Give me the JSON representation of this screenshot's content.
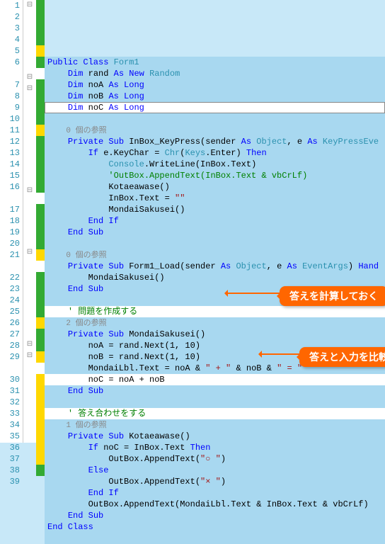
{
  "callouts": {
    "c1": "答えを計算しておく",
    "c2": "答えと入力を比較"
  },
  "refs": {
    "r0": "0 個の参照",
    "r1": "1 個の参照",
    "r2": "2 個の参照"
  },
  "lines": [
    {
      "n": "1",
      "mk": "⊟",
      "mg": "g",
      "cls": "hl",
      "tokens": [
        [
          "kw",
          "Public Class "
        ],
        [
          "tp",
          "Form1"
        ]
      ]
    },
    {
      "n": "2",
      "mg": "g",
      "cls": "hl",
      "tokens": [
        [
          "mt",
          "    "
        ],
        [
          "kw",
          "Dim"
        ],
        [
          "mt",
          " rand "
        ],
        [
          "kw",
          "As New "
        ],
        [
          "tp",
          "Random"
        ]
      ]
    },
    {
      "n": "3",
      "mg": "g",
      "cls": "hl",
      "tokens": [
        [
          "mt",
          "    "
        ],
        [
          "kw",
          "Dim"
        ],
        [
          "mt",
          " noA "
        ],
        [
          "kw",
          "As Long"
        ]
      ]
    },
    {
      "n": "4",
      "mg": "g",
      "cls": "hl",
      "tokens": [
        [
          "mt",
          "    "
        ],
        [
          "kw",
          "Dim"
        ],
        [
          "mt",
          " noB "
        ],
        [
          "kw",
          "As Long"
        ]
      ]
    },
    {
      "n": "5",
      "mg": "y",
      "cls": "line5",
      "tokens": [
        [
          "mt",
          "    "
        ],
        [
          "kw",
          "Dim"
        ],
        [
          "mt",
          " noC "
        ],
        [
          "kw",
          "As Long"
        ]
      ]
    },
    {
      "n": "6",
      "mg": "g",
      "cls": "hl",
      "tokens": [
        [
          "mt",
          " "
        ]
      ]
    },
    {
      "n": "",
      "cls": "hl",
      "tokens": [
        [
          "ref",
          "    0 個の参照"
        ]
      ]
    },
    {
      "n": "7",
      "mk": "⊟",
      "mg": "g",
      "cls": "hl",
      "tokens": [
        [
          "mt",
          "    "
        ],
        [
          "kw",
          "Private Sub "
        ],
        [
          "mt",
          "InBox_KeyPress(sender "
        ],
        [
          "kw",
          "As "
        ],
        [
          "tp",
          "Object"
        ],
        [
          "mt",
          ", e "
        ],
        [
          "kw",
          "As "
        ],
        [
          "tp",
          "KeyPressEve"
        ]
      ]
    },
    {
      "n": "8",
      "mk": "⊟",
      "mg": "g",
      "cls": "hl",
      "tokens": [
        [
          "mt",
          "        "
        ],
        [
          "kw",
          "If"
        ],
        [
          "mt",
          " e.KeyChar = "
        ],
        [
          "tp",
          "Chr"
        ],
        [
          "mt",
          "("
        ],
        [
          "tp",
          "Keys"
        ],
        [
          "mt",
          ".Enter) "
        ],
        [
          "kw",
          "Then"
        ]
      ]
    },
    {
      "n": "9",
      "mg": "g",
      "cls": "hl",
      "tokens": [
        [
          "mt",
          "            "
        ],
        [
          "tp",
          "Console"
        ],
        [
          "mt",
          ".WriteLine(InBox.Text)"
        ]
      ]
    },
    {
      "n": "10",
      "mg": "g",
      "cls": "hl",
      "tokens": [
        [
          "mt",
          "            "
        ],
        [
          "cm",
          "'OutBox.AppendText(InBox.Text & vbCrLf)"
        ]
      ]
    },
    {
      "n": "11",
      "mg": "y",
      "cls": "hl",
      "tokens": [
        [
          "mt",
          "            Kotaeawase()"
        ]
      ]
    },
    {
      "n": "12",
      "mg": "g",
      "cls": "hl",
      "tokens": [
        [
          "mt",
          "            InBox.Text = "
        ],
        [
          "st",
          "\"\""
        ]
      ]
    },
    {
      "n": "13",
      "mg": "g",
      "cls": "hl",
      "tokens": [
        [
          "mt",
          "            MondaiSakusei()"
        ]
      ]
    },
    {
      "n": "14",
      "mg": "g",
      "cls": "hl",
      "tokens": [
        [
          "mt",
          "        "
        ],
        [
          "kw",
          "End If"
        ]
      ]
    },
    {
      "n": "15",
      "mg": "g",
      "cls": "hl",
      "tokens": [
        [
          "mt",
          "    "
        ],
        [
          "kw",
          "End Sub"
        ]
      ]
    },
    {
      "n": "16",
      "mg": "g",
      "cls": "hl",
      "tokens": [
        [
          "mt",
          " "
        ]
      ]
    },
    {
      "n": "",
      "cls": "hl",
      "tokens": [
        [
          "ref",
          "    0 個の参照"
        ]
      ]
    },
    {
      "n": "17",
      "mk": "⊟",
      "mg": "g",
      "cls": "hl",
      "tokens": [
        [
          "mt",
          "    "
        ],
        [
          "kw",
          "Private Sub "
        ],
        [
          "mt",
          "Form1_Load(sender "
        ],
        [
          "kw",
          "As "
        ],
        [
          "tp",
          "Object"
        ],
        [
          "mt",
          ", e "
        ],
        [
          "kw",
          "As "
        ],
        [
          "tp",
          "EventArgs"
        ],
        [
          "mt",
          ") "
        ],
        [
          "kw",
          "Hand"
        ]
      ]
    },
    {
      "n": "18",
      "mg": "g",
      "cls": "hl",
      "tokens": [
        [
          "mt",
          "        MondaiSakusei()"
        ]
      ]
    },
    {
      "n": "19",
      "mg": "g",
      "cls": "hl",
      "tokens": [
        [
          "mt",
          "    "
        ],
        [
          "kw",
          "End Sub"
        ]
      ]
    },
    {
      "n": "20",
      "mg": "g",
      "cls": "hl",
      "tokens": [
        [
          "mt",
          " "
        ]
      ]
    },
    {
      "n": "21",
      "mg": "y",
      "cls": "wh",
      "tokens": [
        [
          "mt",
          "    "
        ],
        [
          "cm",
          "' 問題を作成する"
        ]
      ]
    },
    {
      "n": "",
      "cls": "hl",
      "tokens": [
        [
          "ref",
          "    2 個の参照"
        ]
      ]
    },
    {
      "n": "22",
      "mk": "⊟",
      "mg": "g",
      "cls": "hl",
      "tokens": [
        [
          "mt",
          "    "
        ],
        [
          "kw",
          "Private Sub "
        ],
        [
          "mt",
          "MondaiSakusei()"
        ]
      ]
    },
    {
      "n": "23",
      "mg": "g",
      "cls": "hl",
      "tokens": [
        [
          "mt",
          "        noA = rand.Next(1, 10)"
        ]
      ]
    },
    {
      "n": "24",
      "mg": "g",
      "cls": "hl",
      "tokens": [
        [
          "mt",
          "        noB = rand.Next(1, 10)"
        ]
      ]
    },
    {
      "n": "25",
      "mg": "g",
      "cls": "hl",
      "tokens": [
        [
          "mt",
          "        MondaiLbl.Text = noA & "
        ],
        [
          "st",
          "\" + \""
        ],
        [
          "mt",
          " & noB & "
        ],
        [
          "st",
          "\" = \""
        ]
      ]
    },
    {
      "n": "26",
      "mg": "y",
      "cls": "wh",
      "tokens": [
        [
          "mt",
          "        noC = noA + noB"
        ]
      ]
    },
    {
      "n": "27",
      "mg": "g",
      "cls": "hl",
      "tokens": [
        [
          "mt",
          "    "
        ],
        [
          "kw",
          "End Sub"
        ]
      ]
    },
    {
      "n": "28",
      "mg": "g",
      "cls": "hl",
      "tokens": [
        [
          "mt",
          " "
        ]
      ]
    },
    {
      "n": "29",
      "mg": "y",
      "cls": "wh",
      "tokens": [
        [
          "mt",
          "    "
        ],
        [
          "cm",
          "' 答え合わせをする"
        ]
      ]
    },
    {
      "n": "",
      "cls": "hl",
      "tokens": [
        [
          "ref",
          "    1 個の参照"
        ]
      ]
    },
    {
      "n": "30",
      "mk": "⊟",
      "mg": "y",
      "cls": "hl",
      "tokens": [
        [
          "mt",
          "    "
        ],
        [
          "kw",
          "Private Sub "
        ],
        [
          "mt",
          "Kotaeawase()"
        ]
      ]
    },
    {
      "n": "31",
      "mk": "⊟",
      "mg": "y",
      "cls": "hl",
      "tokens": [
        [
          "mt",
          "        "
        ],
        [
          "kw",
          "If"
        ],
        [
          "mt",
          " noC = InBox.Text "
        ],
        [
          "kw",
          "Then"
        ]
      ]
    },
    {
      "n": "32",
      "mg": "y",
      "cls": "hl",
      "tokens": [
        [
          "mt",
          "            OutBox.AppendText("
        ],
        [
          "st",
          "\"○ \""
        ],
        [
          "mt",
          ")"
        ]
      ]
    },
    {
      "n": "33",
      "mg": "y",
      "cls": "hl",
      "tokens": [
        [
          "mt",
          "        "
        ],
        [
          "kw",
          "Else"
        ]
      ]
    },
    {
      "n": "34",
      "mg": "y",
      "cls": "hl",
      "tokens": [
        [
          "mt",
          "            OutBox.AppendText("
        ],
        [
          "st",
          "\"× \""
        ],
        [
          "mt",
          ")"
        ]
      ]
    },
    {
      "n": "35",
      "mg": "y",
      "cls": "hl",
      "tokens": [
        [
          "mt",
          "        "
        ],
        [
          "kw",
          "End If"
        ]
      ]
    },
    {
      "n": "36",
      "mg": "y",
      "cls": "hl",
      "tokens": [
        [
          "mt",
          "        OutBox.AppendText(MondaiLbl.Text & InBox.Text & vbCrLf)"
        ]
      ]
    },
    {
      "n": "37",
      "mg": "y",
      "cls": "hl",
      "tokens": [
        [
          "mt",
          "    "
        ],
        [
          "kw",
          "End Sub"
        ]
      ]
    },
    {
      "n": "38",
      "mg": "g",
      "cls": "hl",
      "tokens": [
        [
          "kw",
          "End Class"
        ]
      ]
    },
    {
      "n": "39",
      "cls": "hl",
      "tokens": [
        [
          "mt",
          " "
        ]
      ]
    }
  ]
}
